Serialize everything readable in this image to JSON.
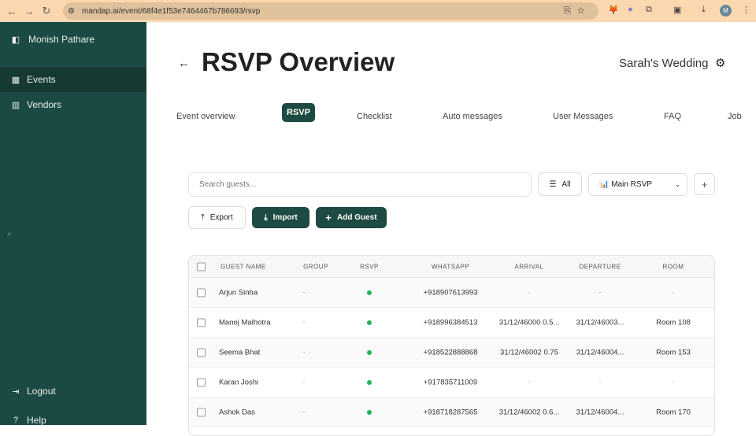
{
  "browser": {
    "url": "mandap.ai/event/68f4e1f53e7464467b786693/rsvp",
    "profile_initial": "M"
  },
  "sidebar": {
    "user": "Monish Pathare",
    "items": [
      {
        "label": "Events"
      },
      {
        "label": "Vendors"
      }
    ],
    "logout": "Logout",
    "help": "Help"
  },
  "header": {
    "title": "RSVP Overview",
    "event_name": "Sarah's Wedding"
  },
  "tabs": [
    {
      "label": "Event overview"
    },
    {
      "label": "RSVP"
    },
    {
      "label": "Checklist"
    },
    {
      "label": "Auto messages"
    },
    {
      "label": "User Messages"
    },
    {
      "label": "FAQ"
    },
    {
      "label": "Job"
    }
  ],
  "toolbar": {
    "search_placeholder": "Search guests...",
    "filter_label": "All",
    "rsvp_select": "📊 Main RSVP",
    "add": "+",
    "export": "Export",
    "import": "Import",
    "add_guest": "Add Guest"
  },
  "table": {
    "columns": [
      "GUEST NAME",
      "GROUP",
      "RSVP",
      "WHATSAPP",
      "ARRIVAL",
      "DEPARTURE",
      "ROOM"
    ],
    "rows": [
      {
        "name": "Arjun Sinha",
        "group": "-",
        "whatsapp": "+918907613993",
        "arrival": "-",
        "departure": "-",
        "room": "-"
      },
      {
        "name": "Manoj Malhotra",
        "group": "-",
        "whatsapp": "+918996384513",
        "arrival": "31/12/46000 0.5...",
        "departure": "31/12/46003...",
        "room": "Room 108"
      },
      {
        "name": "Seema Bhat",
        "group": "-",
        "whatsapp": "+918522888868",
        "arrival": "31/12/46002 0.75",
        "departure": "31/12/46004...",
        "room": "Room 153"
      },
      {
        "name": "Karan Joshi",
        "group": "-",
        "whatsapp": "+917835711009",
        "arrival": "-",
        "departure": "-",
        "room": "-"
      },
      {
        "name": "Ashok Das",
        "group": "-",
        "whatsapp": "+918718287565",
        "arrival": "31/12/46002 0.6...",
        "departure": "31/12/46004...",
        "room": "Room 170"
      }
    ]
  },
  "colors": {
    "sidebar": "#1b4a44",
    "accent": "#1d4a42",
    "rsvp_dot": "#22b455"
  }
}
